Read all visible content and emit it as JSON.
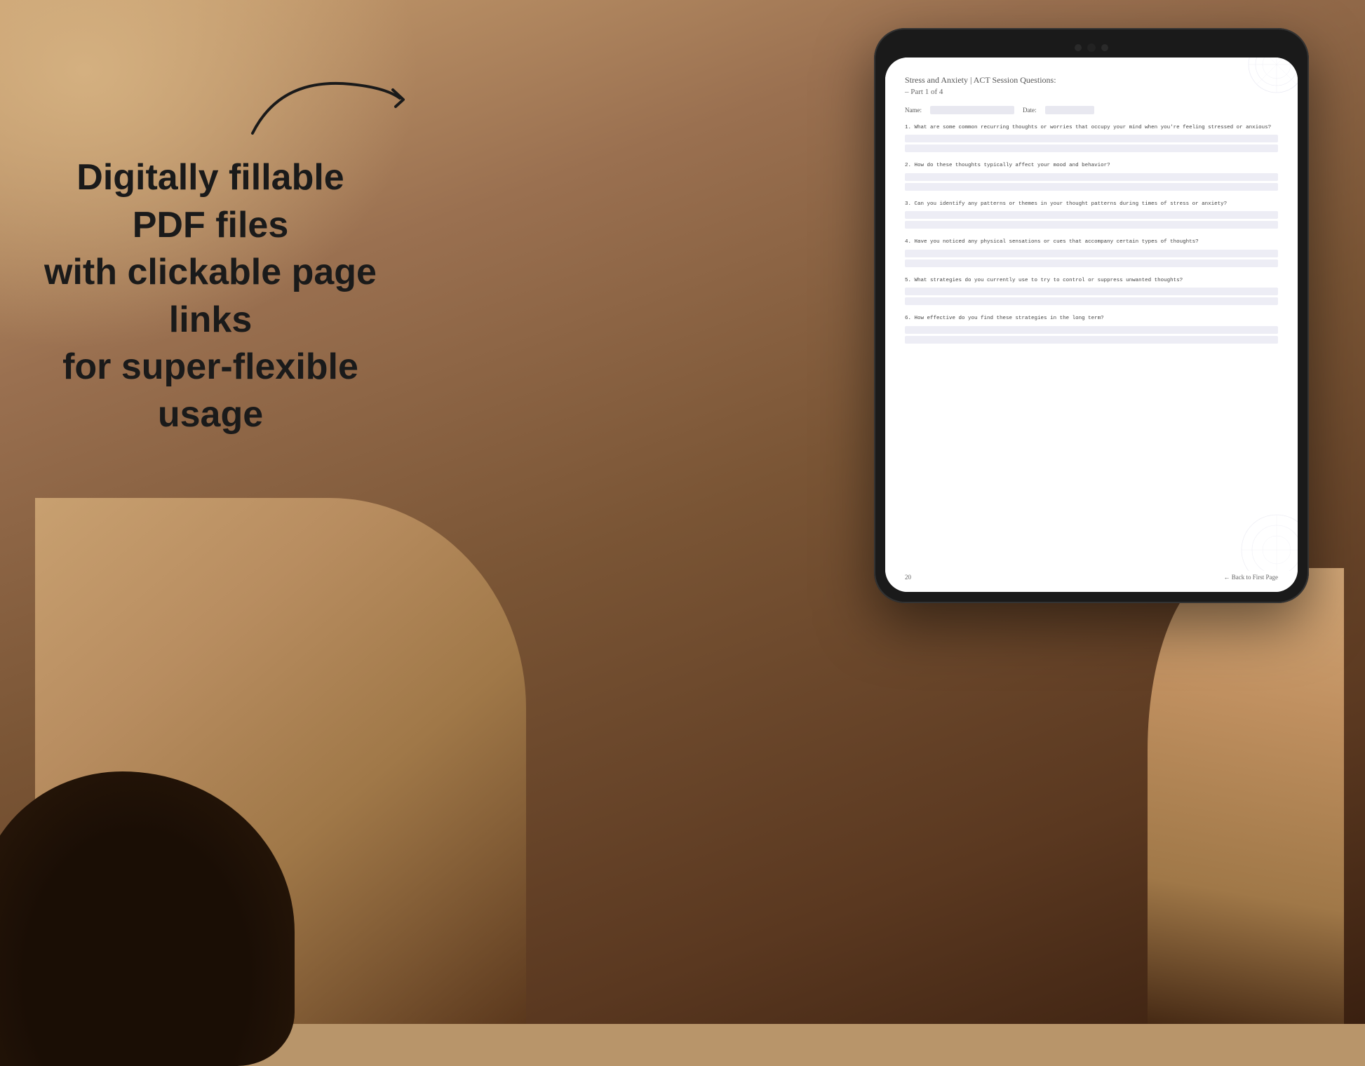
{
  "background": {
    "color": "#b8956a"
  },
  "left_text": {
    "line1": "Digitally fillable PDF files",
    "line2": "with clickable page links",
    "line3": "for super-flexible usage"
  },
  "arrow": {
    "description": "curved arrow pointing right toward tablet"
  },
  "pdf": {
    "title": "Stress and Anxiety | ACT Session Questions:",
    "subtitle": "– Part 1 of 4",
    "fields": {
      "name_label": "Name:",
      "date_label": "Date:"
    },
    "questions": [
      {
        "number": "1.",
        "text": "What are some common recurring thoughts or worries that occupy your mind when you're feeling stressed or anxious?"
      },
      {
        "number": "2.",
        "text": "How do these thoughts typically affect your mood and behavior?"
      },
      {
        "number": "3.",
        "text": "Can you identify any patterns or themes in your thought patterns during times of stress or anxiety?"
      },
      {
        "number": "4.",
        "text": "Have you noticed any physical sensations or cues that accompany certain types of thoughts?"
      },
      {
        "number": "5.",
        "text": "What strategies do you currently use to try to control or suppress unwanted thoughts?"
      },
      {
        "number": "6.",
        "text": "How effective do you find these strategies in the long term?"
      }
    ],
    "footer": {
      "page_number": "20",
      "back_link": "← Back to First Page"
    }
  }
}
